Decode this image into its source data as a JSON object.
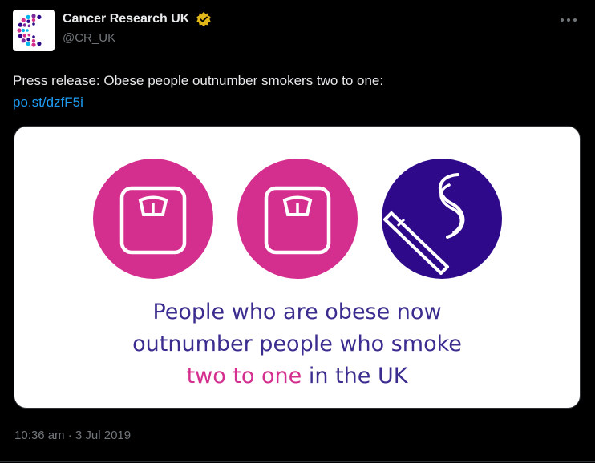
{
  "account": {
    "display_name": "Cancer Research UK",
    "handle": "@CR_UK",
    "verified": true,
    "verified_badge_color": "#e2b719"
  },
  "post": {
    "text": "Press release: Obese people outnumber smokers two to one:",
    "link": "po.st/dzfF5i",
    "timestamp": "10:36 am · 3 Jul 2019"
  },
  "media": {
    "icons": [
      "scale-icon",
      "scale-icon",
      "cigarette-icon"
    ],
    "caption_line1": "People who are obese now",
    "caption_line2": "outnumber people who smoke",
    "caption_highlight": "two to one",
    "caption_end": " in the UK",
    "colors": {
      "pink": "#d42e8f",
      "purple": "#2e0a8a",
      "caption": "#3a2d8f"
    }
  },
  "colors": {
    "background": "#000000",
    "link": "#1d9bf0",
    "muted": "#71767b"
  }
}
